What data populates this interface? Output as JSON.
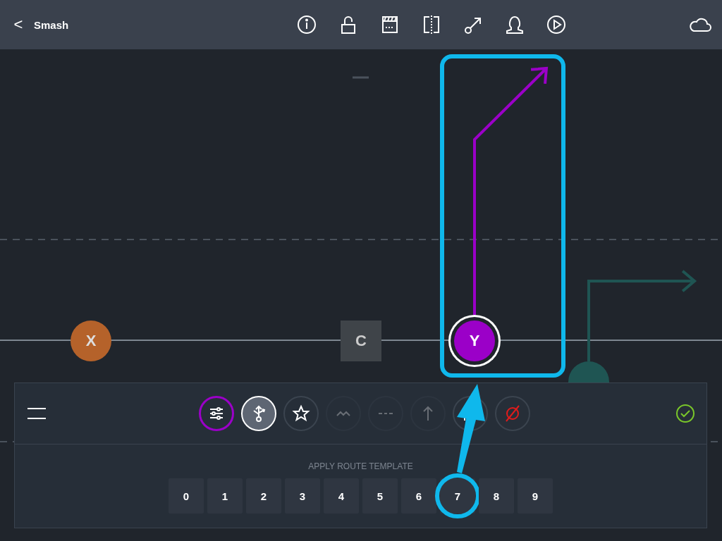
{
  "header": {
    "back": "<",
    "title": "Smash",
    "tools": [
      {
        "kind": "info"
      },
      {
        "kind": "unlock"
      },
      {
        "kind": "clapper"
      },
      {
        "kind": "split"
      },
      {
        "kind": "route"
      },
      {
        "kind": "person"
      },
      {
        "kind": "play"
      }
    ]
  },
  "players": [
    {
      "label": "X",
      "kind": "circle",
      "color": "#b5622a",
      "selected": false
    },
    {
      "label": "C",
      "kind": "square",
      "color": "#3f4449",
      "selected": false
    },
    {
      "label": "Y",
      "kind": "circle",
      "color": "#9b00c8",
      "selected": true
    },
    {
      "kind": "circle",
      "color": "#1f5553",
      "selected": false
    }
  ],
  "routes": [
    {
      "color": "#9b00c8"
    },
    {
      "color": "#1f5553"
    }
  ],
  "panel": {
    "tools": [
      {
        "kind": "settings",
        "selected": false,
        "disabled": false,
        "color": "#9b00c8"
      },
      {
        "kind": "route",
        "selected": true,
        "disabled": false
      },
      {
        "kind": "star",
        "selected": false,
        "disabled": false
      },
      {
        "kind": "zigzag",
        "selected": false,
        "disabled": true
      },
      {
        "kind": "dashed",
        "selected": false,
        "disabled": true
      },
      {
        "kind": "arrow",
        "selected": false,
        "disabled": true
      },
      {
        "kind": "block",
        "selected": false,
        "disabled": false
      },
      {
        "kind": "none",
        "selected": false,
        "disabled": false,
        "color": "#e01b1b"
      }
    ],
    "template_title": "APPLY ROUTE TEMPLATE",
    "templates": [
      {
        "label": "0",
        "highlighted": false
      },
      {
        "label": "1",
        "highlighted": false
      },
      {
        "label": "2",
        "highlighted": false
      },
      {
        "label": "3",
        "highlighted": false
      },
      {
        "label": "4",
        "highlighted": false
      },
      {
        "label": "5",
        "highlighted": false
      },
      {
        "label": "6",
        "highlighted": false
      },
      {
        "label": "7",
        "highlighted": true
      },
      {
        "label": "8",
        "highlighted": false
      },
      {
        "label": "9",
        "highlighted": false
      }
    ]
  }
}
